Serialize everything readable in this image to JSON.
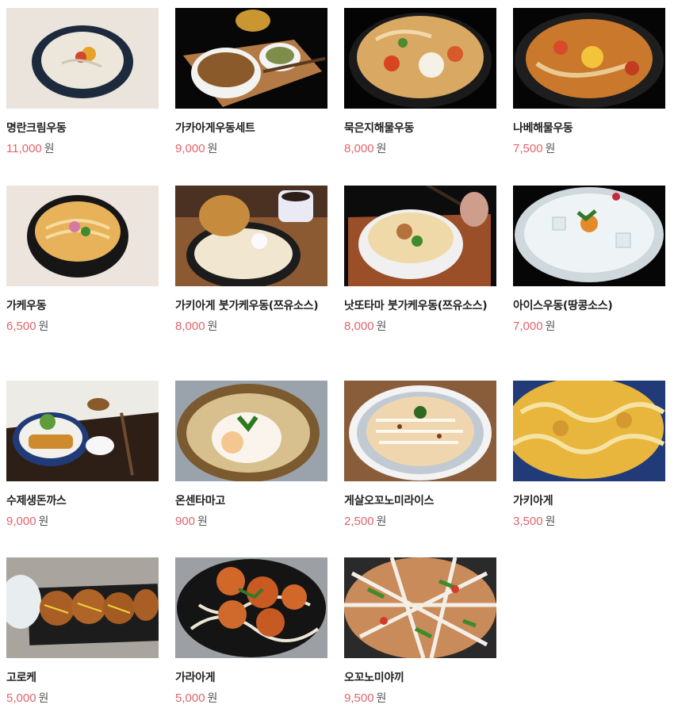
{
  "menu": {
    "items": [
      {
        "name": "명란크림우동",
        "price": "11,000",
        "unit": "원",
        "photo": "myeongnan-cream-udon-photo"
      },
      {
        "name": "가카아게우동세트",
        "price": "9,000",
        "unit": "원",
        "photo": "kakiage-udon-set-photo"
      },
      {
        "name": "묵은지해물우동",
        "price": "8,000",
        "unit": "원",
        "photo": "mukeunji-seafood-udon-photo"
      },
      {
        "name": "나베해물우동",
        "price": "7,500",
        "unit": "원",
        "photo": "nabe-seafood-udon-photo"
      },
      {
        "name": "가케우동",
        "price": "6,500",
        "unit": "원",
        "photo": "kake-udon-photo"
      },
      {
        "name": "가키아게 붓가케우동(쯔유소스)",
        "price": "8,000",
        "unit": "원",
        "photo": "kakiage-bukkake-udon-photo"
      },
      {
        "name": "낫또타마 붓가케우동(쯔유소스)",
        "price": "8,000",
        "unit": "원",
        "photo": "natto-tama-bukkake-udon-photo"
      },
      {
        "name": "아이스우동(땅콩소스)",
        "price": "7,000",
        "unit": "원",
        "photo": "ice-udon-photo"
      },
      {
        "name": "수제생돈까스",
        "price": "9,000",
        "unit": "원",
        "photo": "tonkatsu-photo"
      },
      {
        "name": "온센타마고",
        "price": "900",
        "unit": "원",
        "photo": "onsen-tamago-photo"
      },
      {
        "name": "게살오꼬노미라이스",
        "price": "2,500",
        "unit": "원",
        "photo": "crab-okonomi-rice-photo"
      },
      {
        "name": "가키아게",
        "price": "3,500",
        "unit": "원",
        "photo": "kakiage-photo"
      },
      {
        "name": "고로케",
        "price": "5,000",
        "unit": "원",
        "photo": "croquette-photo"
      },
      {
        "name": "가라아게",
        "price": "5,000",
        "unit": "원",
        "photo": "karaage-photo"
      },
      {
        "name": "오꼬노미야끼",
        "price": "9,500",
        "unit": "원",
        "photo": "okonomiyaki-photo"
      }
    ]
  },
  "colors": {
    "price": "#e2636b",
    "name": "#222222",
    "unit": "#555555"
  }
}
